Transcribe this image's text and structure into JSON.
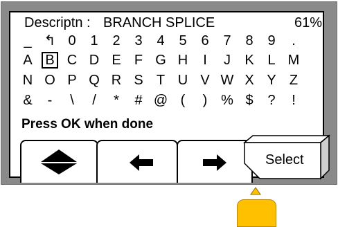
{
  "header": {
    "description_label": "Descriptn :",
    "description_value": "BRANCH SPLICE",
    "battery_percent": "61%"
  },
  "keyboard": {
    "rows": [
      [
        "_",
        "↰",
        "0",
        "1",
        "2",
        "3",
        "4",
        "5",
        "6",
        "7",
        "8",
        "9",
        "."
      ],
      [
        "A",
        "B",
        "C",
        "D",
        "E",
        "F",
        "G",
        "H",
        "I",
        "J",
        "K",
        "L",
        "M"
      ],
      [
        "N",
        "O",
        "P",
        "Q",
        "R",
        "S",
        "T",
        "U",
        "V",
        "W",
        "X",
        "Y",
        "Z"
      ],
      [
        "&",
        "-",
        "\\",
        "/",
        "*",
        "#",
        "@",
        "(",
        ")",
        "%",
        "$",
        "?",
        "!"
      ]
    ],
    "selected_key": "B"
  },
  "prompt": "Press OK when done",
  "softkeys": {
    "key1_icon": "up-down-arrows-icon",
    "key2_icon": "left-arrow-icon",
    "key3_icon": "right-arrow-icon",
    "key4_label": "Select"
  },
  "colors": {
    "frame": "#8a8a8a",
    "screen": "#ffffff",
    "ok_button": "#ffc000"
  }
}
